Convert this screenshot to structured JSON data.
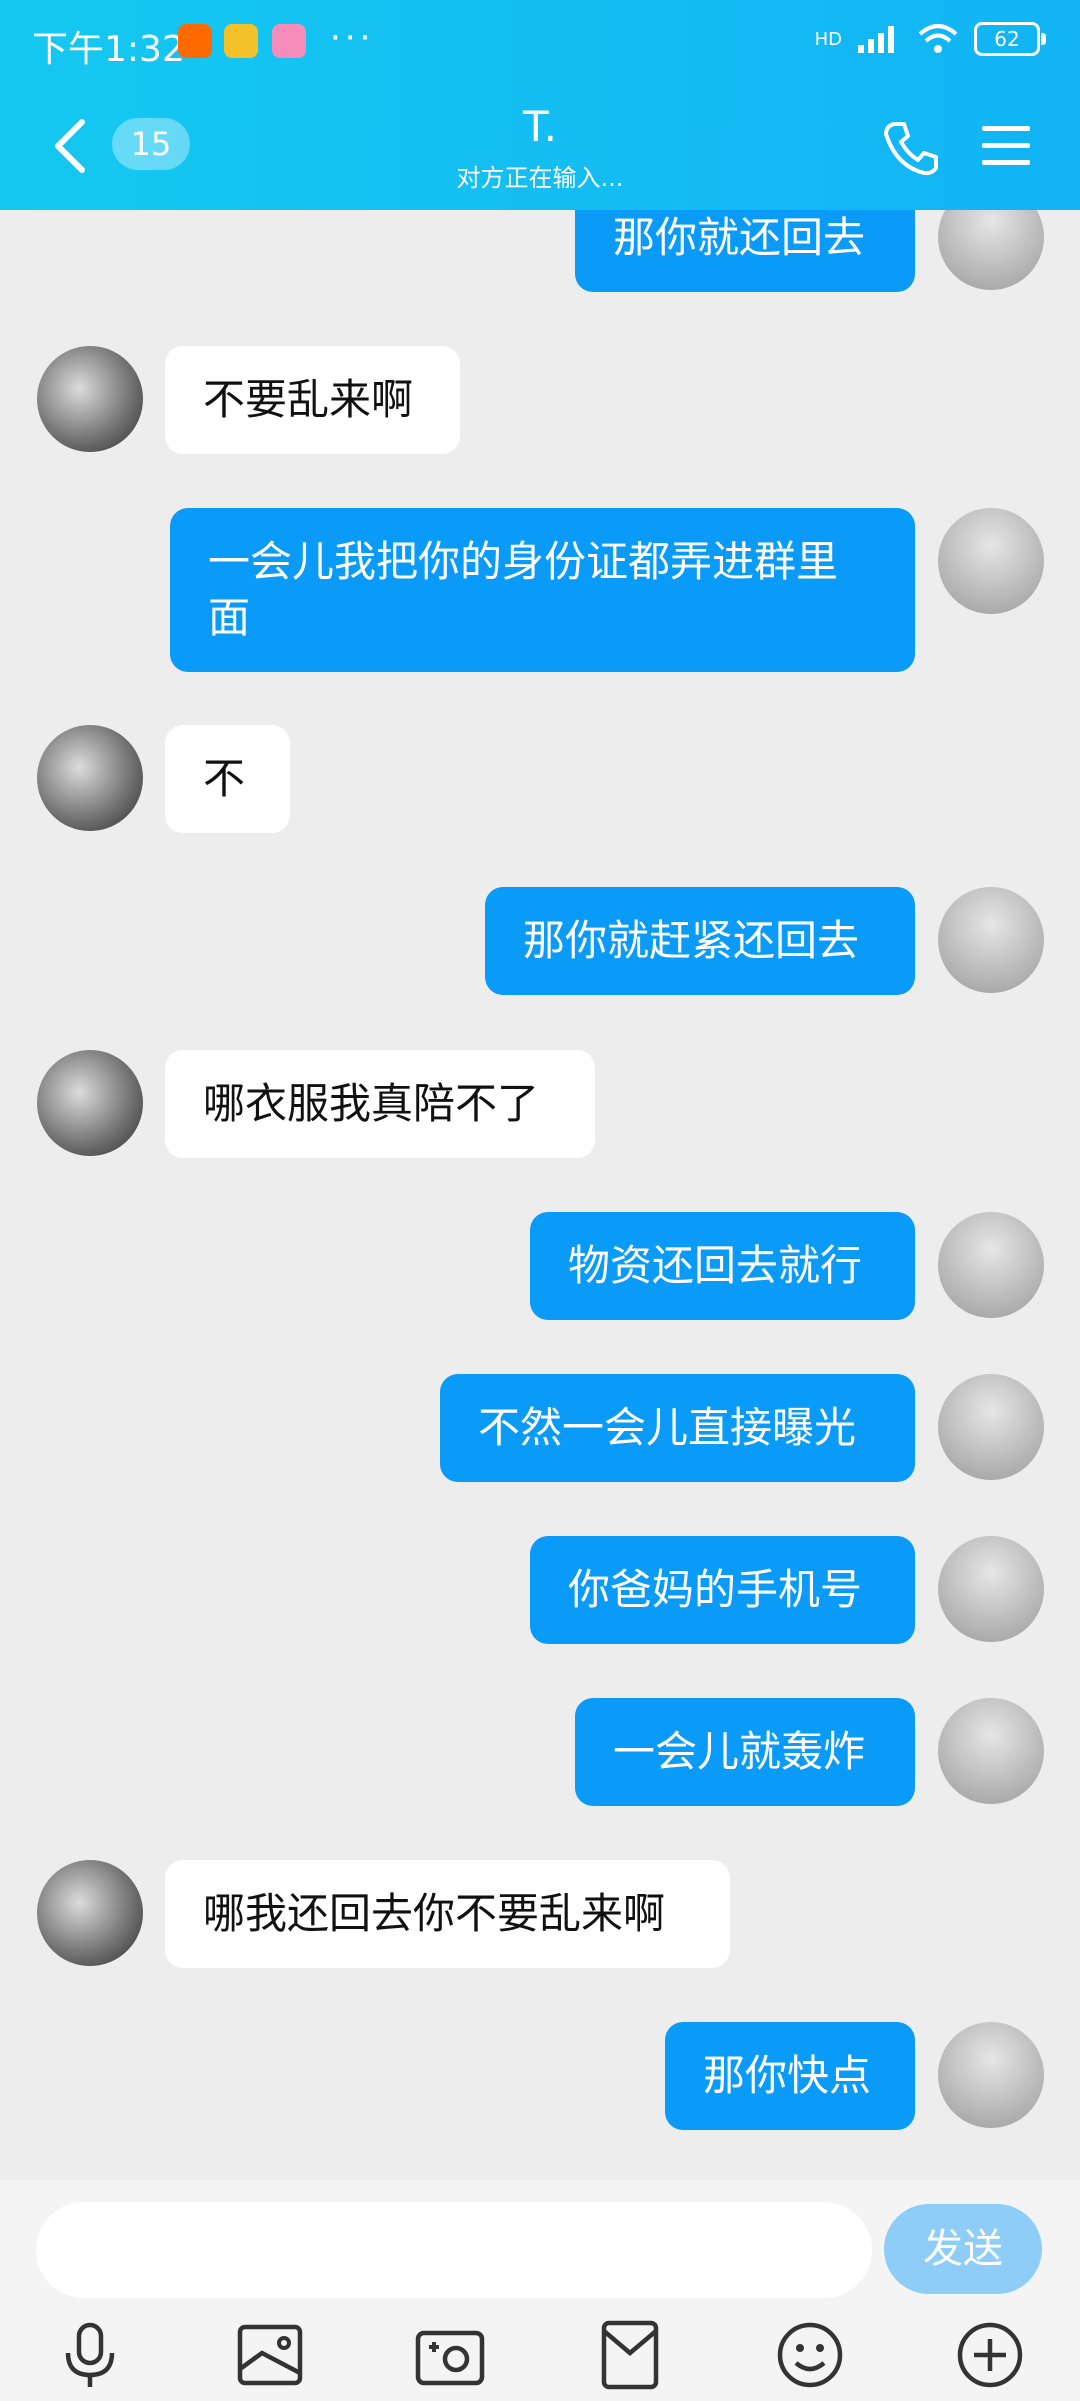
{
  "status_bar": {
    "time": "下午1:32",
    "more": "···",
    "network": "HD",
    "battery": "62"
  },
  "header": {
    "back_count": "15",
    "title": "T.",
    "subtitle": "对方正在输入..."
  },
  "messages": [
    {
      "side": "mine",
      "text": "那你就还回去"
    },
    {
      "side": "theirs",
      "text": "不要乱来啊"
    },
    {
      "side": "mine",
      "text": "一会儿我把你的身份证都弄进群里面"
    },
    {
      "side": "theirs",
      "text": "不"
    },
    {
      "side": "mine",
      "text": "那你就赶紧还回去"
    },
    {
      "side": "theirs",
      "text": "哪衣服我真陪不了"
    },
    {
      "side": "mine",
      "text": "物资还回去就行"
    },
    {
      "side": "mine",
      "text": "不然一会儿直接曝光"
    },
    {
      "side": "mine",
      "text": "你爸妈的手机号"
    },
    {
      "side": "mine",
      "text": "一会儿就轰炸"
    },
    {
      "side": "theirs",
      "text": "哪我还回去你不要乱来啊"
    },
    {
      "side": "mine",
      "text": "那你快点"
    }
  ],
  "composer": {
    "placeholder": "",
    "send_label": "发送"
  },
  "toolbar": [
    "microphone-icon",
    "image-icon",
    "camera-icon",
    "red-packet-icon",
    "emoji-icon",
    "plus-icon"
  ],
  "colors": {
    "header": "#12b4f4",
    "my_bubble": "#0a9af8",
    "send_button": "#8dcdf7"
  }
}
